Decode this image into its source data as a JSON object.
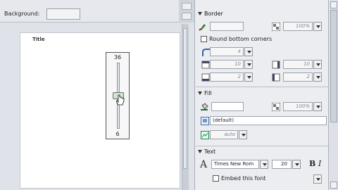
{
  "toolbar": {
    "background_label": "Background:"
  },
  "canvas": {
    "title": "Title"
  },
  "slider": {
    "max_label": "36",
    "min_label": "6"
  },
  "border": {
    "heading": "Border",
    "alpha_value": "100%",
    "round_corners_label": "Round bottom corners",
    "radius_value": "4",
    "top_value": "10",
    "right_value": "10",
    "bottom_value": "2",
    "left_value": "2"
  },
  "fill": {
    "heading": "Fill",
    "alpha_value": "100%",
    "image_value": "(default)",
    "mode_value": "auto"
  },
  "text": {
    "heading": "Text",
    "font_value": "Times New Rom",
    "size_value": "20",
    "bold_label": "B",
    "italic_label": "I",
    "embed_label": "Embed this font"
  },
  "icons": [
    "pen-icon",
    "checkerboard-icon",
    "corner-radius-icon",
    "padding-icon",
    "paint-bucket-icon",
    "image-icon",
    "text-icon",
    "cursor-icon"
  ]
}
